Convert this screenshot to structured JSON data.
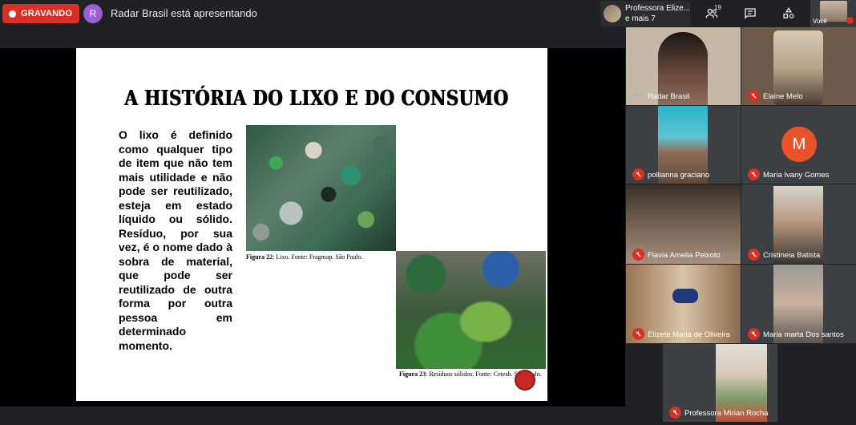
{
  "recording": {
    "label": "GRAVANDO"
  },
  "presenter": {
    "initial": "R",
    "text": "Radar Brasil está apresentando"
  },
  "pinned": {
    "line1": "Professora Elize...",
    "line2": "e mais 7"
  },
  "controls": {
    "people_count": "19"
  },
  "self_view": {
    "label": "Você"
  },
  "slide": {
    "title": "A HISTÓRIA DO LIXO E DO CONSUMO",
    "body": "O lixo é definido como qualquer tipo de item que não tem mais utilidade e não pode ser reutilizado, esteja em estado líquido ou sólido. Resíduo, por sua vez, é o nome dado à sobra de material, que pode ser reutilizado de outra forma por outra pessoa em determinado momento.",
    "caption1_bold": "Figura 22",
    "caption1_rest": ": Lixo. Fonte: Fragmap. São Paulo.",
    "caption2_bold": "Figura 23",
    "caption2_rest": ": Resíduos sólidos. Fonte: Cetesb. São Paulo."
  },
  "participants": [
    {
      "name": "Radar Brasil",
      "state": "speaking"
    },
    {
      "name": "Elaine Melo",
      "state": "muted"
    },
    {
      "name": "pollianna graciano",
      "state": "muted"
    },
    {
      "name": "Maria Ivany Gomes",
      "state": "muted",
      "initial": "M"
    },
    {
      "name": "Flavia Amelia Peixoto",
      "state": "muted"
    },
    {
      "name": "Cristineia Batista",
      "state": "muted"
    },
    {
      "name": "Elizete Maria de Oliveira",
      "state": "muted"
    },
    {
      "name": "Maria marta Dos santos",
      "state": "muted"
    },
    {
      "name": "Professora Mirian Rocha",
      "state": "muted"
    }
  ],
  "colors": {
    "record": "#d93025",
    "presenter_avatar": "#9c5dd6",
    "avatar_m": "#e8542a",
    "background": "#202124",
    "tile": "#3c4043"
  },
  "icons": [
    "record-dot-icon",
    "people-icon",
    "chat-icon",
    "activities-icon",
    "mic-off-icon",
    "speaking-dots-icon"
  ]
}
